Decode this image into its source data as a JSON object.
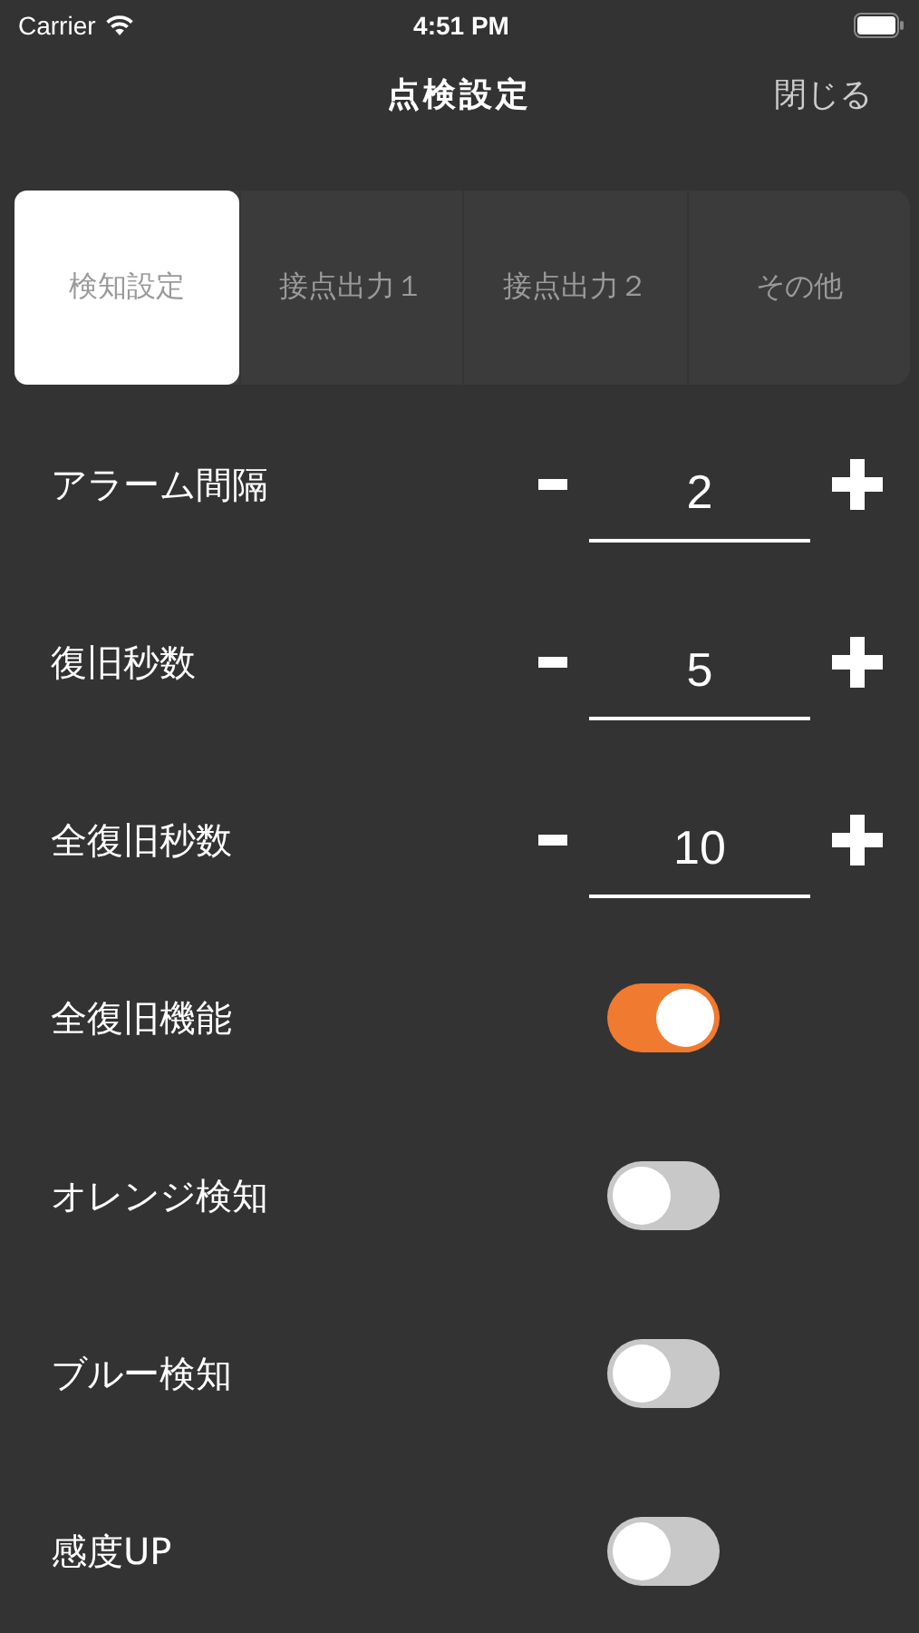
{
  "status_bar": {
    "carrier": "Carrier",
    "time": "4:51 PM"
  },
  "nav": {
    "title": "点検設定",
    "close": "閉じる"
  },
  "tabs": [
    {
      "label": "検知設定",
      "selected": true
    },
    {
      "label": "接点出力１",
      "selected": false
    },
    {
      "label": "接点出力２",
      "selected": false
    },
    {
      "label": "その他",
      "selected": false
    }
  ],
  "settings": [
    {
      "kind": "stepper",
      "label": "アラーム間隔",
      "value": "2"
    },
    {
      "kind": "stepper",
      "label": "復旧秒数",
      "value": "5"
    },
    {
      "kind": "stepper",
      "label": "全復旧秒数",
      "value": "10"
    },
    {
      "kind": "toggle",
      "label": "全復旧機能",
      "on": true
    },
    {
      "kind": "toggle",
      "label": "オレンジ検知",
      "on": false
    },
    {
      "kind": "toggle",
      "label": "ブルー検知",
      "on": false
    },
    {
      "kind": "toggle",
      "label": "感度UP",
      "on": false
    }
  ]
}
